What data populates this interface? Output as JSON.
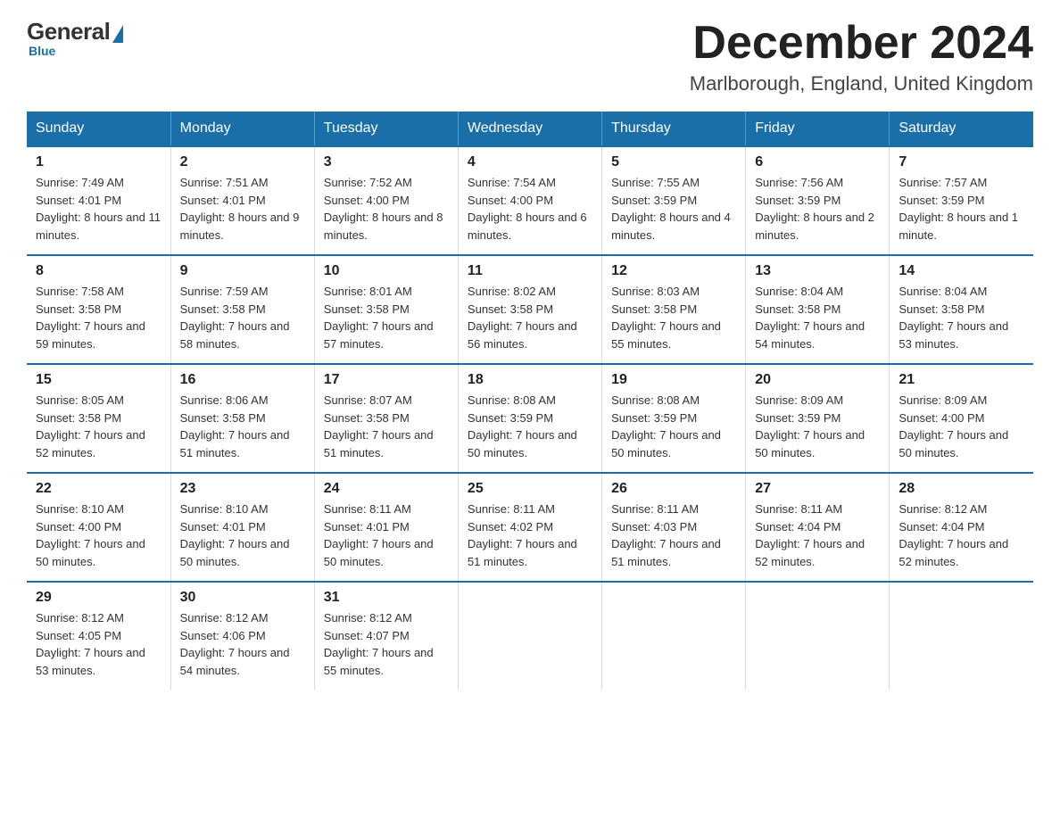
{
  "logo": {
    "general": "General",
    "blue": "Blue",
    "subtitle": "Blue"
  },
  "header": {
    "title": "December 2024",
    "subtitle": "Marlborough, England, United Kingdom"
  },
  "days_of_week": [
    "Sunday",
    "Monday",
    "Tuesday",
    "Wednesday",
    "Thursday",
    "Friday",
    "Saturday"
  ],
  "weeks": [
    [
      {
        "day": "1",
        "sunrise": "7:49 AM",
        "sunset": "4:01 PM",
        "daylight": "8 hours and 11 minutes."
      },
      {
        "day": "2",
        "sunrise": "7:51 AM",
        "sunset": "4:01 PM",
        "daylight": "8 hours and 9 minutes."
      },
      {
        "day": "3",
        "sunrise": "7:52 AM",
        "sunset": "4:00 PM",
        "daylight": "8 hours and 8 minutes."
      },
      {
        "day": "4",
        "sunrise": "7:54 AM",
        "sunset": "4:00 PM",
        "daylight": "8 hours and 6 minutes."
      },
      {
        "day": "5",
        "sunrise": "7:55 AM",
        "sunset": "3:59 PM",
        "daylight": "8 hours and 4 minutes."
      },
      {
        "day": "6",
        "sunrise": "7:56 AM",
        "sunset": "3:59 PM",
        "daylight": "8 hours and 2 minutes."
      },
      {
        "day": "7",
        "sunrise": "7:57 AM",
        "sunset": "3:59 PM",
        "daylight": "8 hours and 1 minute."
      }
    ],
    [
      {
        "day": "8",
        "sunrise": "7:58 AM",
        "sunset": "3:58 PM",
        "daylight": "7 hours and 59 minutes."
      },
      {
        "day": "9",
        "sunrise": "7:59 AM",
        "sunset": "3:58 PM",
        "daylight": "7 hours and 58 minutes."
      },
      {
        "day": "10",
        "sunrise": "8:01 AM",
        "sunset": "3:58 PM",
        "daylight": "7 hours and 57 minutes."
      },
      {
        "day": "11",
        "sunrise": "8:02 AM",
        "sunset": "3:58 PM",
        "daylight": "7 hours and 56 minutes."
      },
      {
        "day": "12",
        "sunrise": "8:03 AM",
        "sunset": "3:58 PM",
        "daylight": "7 hours and 55 minutes."
      },
      {
        "day": "13",
        "sunrise": "8:04 AM",
        "sunset": "3:58 PM",
        "daylight": "7 hours and 54 minutes."
      },
      {
        "day": "14",
        "sunrise": "8:04 AM",
        "sunset": "3:58 PM",
        "daylight": "7 hours and 53 minutes."
      }
    ],
    [
      {
        "day": "15",
        "sunrise": "8:05 AM",
        "sunset": "3:58 PM",
        "daylight": "7 hours and 52 minutes."
      },
      {
        "day": "16",
        "sunrise": "8:06 AM",
        "sunset": "3:58 PM",
        "daylight": "7 hours and 51 minutes."
      },
      {
        "day": "17",
        "sunrise": "8:07 AM",
        "sunset": "3:58 PM",
        "daylight": "7 hours and 51 minutes."
      },
      {
        "day": "18",
        "sunrise": "8:08 AM",
        "sunset": "3:59 PM",
        "daylight": "7 hours and 50 minutes."
      },
      {
        "day": "19",
        "sunrise": "8:08 AM",
        "sunset": "3:59 PM",
        "daylight": "7 hours and 50 minutes."
      },
      {
        "day": "20",
        "sunrise": "8:09 AM",
        "sunset": "3:59 PM",
        "daylight": "7 hours and 50 minutes."
      },
      {
        "day": "21",
        "sunrise": "8:09 AM",
        "sunset": "4:00 PM",
        "daylight": "7 hours and 50 minutes."
      }
    ],
    [
      {
        "day": "22",
        "sunrise": "8:10 AM",
        "sunset": "4:00 PM",
        "daylight": "7 hours and 50 minutes."
      },
      {
        "day": "23",
        "sunrise": "8:10 AM",
        "sunset": "4:01 PM",
        "daylight": "7 hours and 50 minutes."
      },
      {
        "day": "24",
        "sunrise": "8:11 AM",
        "sunset": "4:01 PM",
        "daylight": "7 hours and 50 minutes."
      },
      {
        "day": "25",
        "sunrise": "8:11 AM",
        "sunset": "4:02 PM",
        "daylight": "7 hours and 51 minutes."
      },
      {
        "day": "26",
        "sunrise": "8:11 AM",
        "sunset": "4:03 PM",
        "daylight": "7 hours and 51 minutes."
      },
      {
        "day": "27",
        "sunrise": "8:11 AM",
        "sunset": "4:04 PM",
        "daylight": "7 hours and 52 minutes."
      },
      {
        "day": "28",
        "sunrise": "8:12 AM",
        "sunset": "4:04 PM",
        "daylight": "7 hours and 52 minutes."
      }
    ],
    [
      {
        "day": "29",
        "sunrise": "8:12 AM",
        "sunset": "4:05 PM",
        "daylight": "7 hours and 53 minutes."
      },
      {
        "day": "30",
        "sunrise": "8:12 AM",
        "sunset": "4:06 PM",
        "daylight": "7 hours and 54 minutes."
      },
      {
        "day": "31",
        "sunrise": "8:12 AM",
        "sunset": "4:07 PM",
        "daylight": "7 hours and 55 minutes."
      },
      null,
      null,
      null,
      null
    ]
  ]
}
